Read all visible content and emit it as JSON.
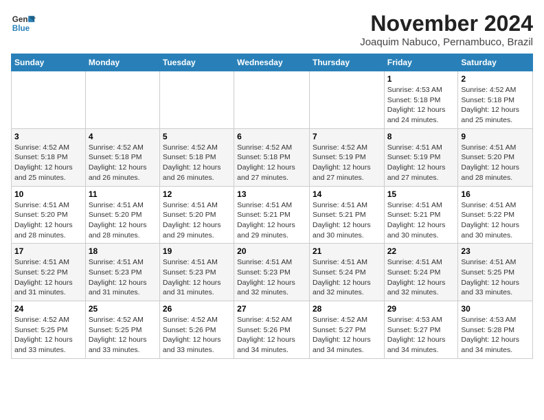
{
  "logo": {
    "line1": "General",
    "line2": "Blue"
  },
  "title": "November 2024",
  "location": "Joaquim Nabuco, Pernambuco, Brazil",
  "weekdays": [
    "Sunday",
    "Monday",
    "Tuesday",
    "Wednesday",
    "Thursday",
    "Friday",
    "Saturday"
  ],
  "weeks": [
    [
      {
        "day": "",
        "info": ""
      },
      {
        "day": "",
        "info": ""
      },
      {
        "day": "",
        "info": ""
      },
      {
        "day": "",
        "info": ""
      },
      {
        "day": "",
        "info": ""
      },
      {
        "day": "1",
        "info": "Sunrise: 4:53 AM\nSunset: 5:18 PM\nDaylight: 12 hours and 24 minutes."
      },
      {
        "day": "2",
        "info": "Sunrise: 4:52 AM\nSunset: 5:18 PM\nDaylight: 12 hours and 25 minutes."
      }
    ],
    [
      {
        "day": "3",
        "info": "Sunrise: 4:52 AM\nSunset: 5:18 PM\nDaylight: 12 hours and 25 minutes."
      },
      {
        "day": "4",
        "info": "Sunrise: 4:52 AM\nSunset: 5:18 PM\nDaylight: 12 hours and 26 minutes."
      },
      {
        "day": "5",
        "info": "Sunrise: 4:52 AM\nSunset: 5:18 PM\nDaylight: 12 hours and 26 minutes."
      },
      {
        "day": "6",
        "info": "Sunrise: 4:52 AM\nSunset: 5:18 PM\nDaylight: 12 hours and 27 minutes."
      },
      {
        "day": "7",
        "info": "Sunrise: 4:52 AM\nSunset: 5:19 PM\nDaylight: 12 hours and 27 minutes."
      },
      {
        "day": "8",
        "info": "Sunrise: 4:51 AM\nSunset: 5:19 PM\nDaylight: 12 hours and 27 minutes."
      },
      {
        "day": "9",
        "info": "Sunrise: 4:51 AM\nSunset: 5:20 PM\nDaylight: 12 hours and 28 minutes."
      }
    ],
    [
      {
        "day": "10",
        "info": "Sunrise: 4:51 AM\nSunset: 5:20 PM\nDaylight: 12 hours and 28 minutes."
      },
      {
        "day": "11",
        "info": "Sunrise: 4:51 AM\nSunset: 5:20 PM\nDaylight: 12 hours and 28 minutes."
      },
      {
        "day": "12",
        "info": "Sunrise: 4:51 AM\nSunset: 5:20 PM\nDaylight: 12 hours and 29 minutes."
      },
      {
        "day": "13",
        "info": "Sunrise: 4:51 AM\nSunset: 5:21 PM\nDaylight: 12 hours and 29 minutes."
      },
      {
        "day": "14",
        "info": "Sunrise: 4:51 AM\nSunset: 5:21 PM\nDaylight: 12 hours and 30 minutes."
      },
      {
        "day": "15",
        "info": "Sunrise: 4:51 AM\nSunset: 5:21 PM\nDaylight: 12 hours and 30 minutes."
      },
      {
        "day": "16",
        "info": "Sunrise: 4:51 AM\nSunset: 5:22 PM\nDaylight: 12 hours and 30 minutes."
      }
    ],
    [
      {
        "day": "17",
        "info": "Sunrise: 4:51 AM\nSunset: 5:22 PM\nDaylight: 12 hours and 31 minutes."
      },
      {
        "day": "18",
        "info": "Sunrise: 4:51 AM\nSunset: 5:23 PM\nDaylight: 12 hours and 31 minutes."
      },
      {
        "day": "19",
        "info": "Sunrise: 4:51 AM\nSunset: 5:23 PM\nDaylight: 12 hours and 31 minutes."
      },
      {
        "day": "20",
        "info": "Sunrise: 4:51 AM\nSunset: 5:23 PM\nDaylight: 12 hours and 32 minutes."
      },
      {
        "day": "21",
        "info": "Sunrise: 4:51 AM\nSunset: 5:24 PM\nDaylight: 12 hours and 32 minutes."
      },
      {
        "day": "22",
        "info": "Sunrise: 4:51 AM\nSunset: 5:24 PM\nDaylight: 12 hours and 32 minutes."
      },
      {
        "day": "23",
        "info": "Sunrise: 4:51 AM\nSunset: 5:25 PM\nDaylight: 12 hours and 33 minutes."
      }
    ],
    [
      {
        "day": "24",
        "info": "Sunrise: 4:52 AM\nSunset: 5:25 PM\nDaylight: 12 hours and 33 minutes."
      },
      {
        "day": "25",
        "info": "Sunrise: 4:52 AM\nSunset: 5:25 PM\nDaylight: 12 hours and 33 minutes."
      },
      {
        "day": "26",
        "info": "Sunrise: 4:52 AM\nSunset: 5:26 PM\nDaylight: 12 hours and 33 minutes."
      },
      {
        "day": "27",
        "info": "Sunrise: 4:52 AM\nSunset: 5:26 PM\nDaylight: 12 hours and 34 minutes."
      },
      {
        "day": "28",
        "info": "Sunrise: 4:52 AM\nSunset: 5:27 PM\nDaylight: 12 hours and 34 minutes."
      },
      {
        "day": "29",
        "info": "Sunrise: 4:53 AM\nSunset: 5:27 PM\nDaylight: 12 hours and 34 minutes."
      },
      {
        "day": "30",
        "info": "Sunrise: 4:53 AM\nSunset: 5:28 PM\nDaylight: 12 hours and 34 minutes."
      }
    ]
  ]
}
